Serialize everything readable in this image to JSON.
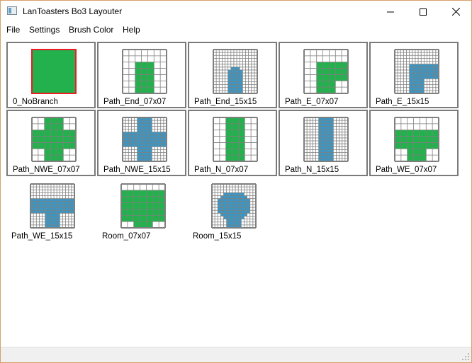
{
  "window": {
    "title": "LanToasters Bo3 Layouter",
    "icon": "app-window-icon",
    "controls": {
      "minimize": "—",
      "maximize": "☐",
      "close": "✕"
    }
  },
  "menu": [
    "File",
    "Settings",
    "Brush Color",
    "Help"
  ],
  "colors": {
    "green": "#22b14c",
    "blue": "#3399cc",
    "grid_line": "#7f7f7f",
    "selection": "#ed1c24"
  },
  "tiles": [
    {
      "label": "0_NoBranch",
      "type": "solid",
      "color": "green",
      "selected": true
    },
    {
      "label": "Path_End_07x07",
      "type": "pattern",
      "size": 7,
      "color": "green",
      "rows": [
        "0000000",
        "0000000",
        "0011100",
        "0011100",
        "0011100",
        "0011100",
        "0011100"
      ]
    },
    {
      "label": "Path_End_15x15",
      "type": "pattern",
      "size": 15,
      "color": "blue",
      "rows": [
        "000000000000000",
        "000000000000000",
        "000000000000000",
        "000000000000000",
        "000000000000000",
        "000000000000000",
        "000000111000000",
        "000001111100000",
        "000001111100000",
        "000001111100000",
        "000001111100000",
        "000001111100000",
        "000001111100000",
        "000001111100000",
        "000001111100000"
      ]
    },
    {
      "label": "Path_E_07x07",
      "type": "pattern",
      "size": 7,
      "color": "green",
      "rows": [
        "0000000",
        "0000000",
        "0011111",
        "0011111",
        "0011111",
        "0011100",
        "0011100"
      ]
    },
    {
      "label": "Path_E_15x15",
      "type": "pattern",
      "size": 15,
      "color": "blue",
      "rows": [
        "000000000000000",
        "000000000000000",
        "000000000000000",
        "000000000000000",
        "000000000000000",
        "000001111111111",
        "000001111111111",
        "000001111111111",
        "000001111111111",
        "000001111111111",
        "000001111100000",
        "000001111100000",
        "000001111100000",
        "000001111100000",
        "000001111100000"
      ]
    },
    {
      "label": "Path_NWE_07x07",
      "type": "pattern",
      "size": 7,
      "color": "green",
      "rows": [
        "0011100",
        "0011100",
        "1111111",
        "1111111",
        "1111111",
        "0011100",
        "0011100"
      ]
    },
    {
      "label": "Path_NWE_15x15",
      "type": "pattern",
      "size": 15,
      "color": "blue",
      "rows": [
        "000001111100000",
        "000001111100000",
        "000001111100000",
        "000001111100000",
        "000001111100000",
        "111111111111111",
        "111111111111111",
        "111111111111111",
        "111111111111111",
        "111111111111111",
        "000001111100000",
        "000001111100000",
        "000001111100000",
        "000001111100000",
        "000001111100000"
      ]
    },
    {
      "label": "Path_N_07x07",
      "type": "pattern",
      "size": 7,
      "color": "green",
      "rows": [
        "0011100",
        "0011100",
        "0011100",
        "0011100",
        "0011100",
        "0011100",
        "0011100"
      ]
    },
    {
      "label": "Path_N_15x15",
      "type": "pattern",
      "size": 15,
      "color": "blue",
      "rows": [
        "000001111100000",
        "000001111100000",
        "000001111100000",
        "000001111100000",
        "000001111100000",
        "000001111100000",
        "000001111100000",
        "000001111100000",
        "000001111100000",
        "000001111100000",
        "000001111100000",
        "000001111100000",
        "000001111100000",
        "000001111100000",
        "000001111100000"
      ]
    },
    {
      "label": "Path_WE_07x07",
      "type": "pattern",
      "size": 7,
      "color": "green",
      "rows": [
        "0000000",
        "0000000",
        "1111111",
        "1111111",
        "1111111",
        "0011100",
        "0011100"
      ]
    },
    {
      "label": "Path_WE_15x15",
      "type": "pattern",
      "size": 15,
      "color": "blue",
      "rows": [
        "000000000000000",
        "000000000000000",
        "000000000000000",
        "000000000000000",
        "000000000000000",
        "111111111111111",
        "111111111111111",
        "111111111111111",
        "111111111111111",
        "111111111111111",
        "000001111100000",
        "000001111100000",
        "000001111100000",
        "000001111100000",
        "000001111100000"
      ]
    },
    {
      "label": "Room_07x07",
      "type": "pattern",
      "size": 7,
      "color": "green",
      "rows": [
        "0000000",
        "1111111",
        "1111111",
        "1111111",
        "1111111",
        "1111111",
        "0011100"
      ]
    },
    {
      "label": "Room_15x15",
      "type": "pattern",
      "size": 15,
      "color": "blue",
      "rows": [
        "000000000000000",
        "000000000000000",
        "000000000000000",
        "000011111110000",
        "000111111111000",
        "001111111111100",
        "001111111111100",
        "001111111111100",
        "001111111111100",
        "001111111111100",
        "000111111111000",
        "000011111110000",
        "000001111100000",
        "000001111100000",
        "000001111100000"
      ]
    }
  ]
}
